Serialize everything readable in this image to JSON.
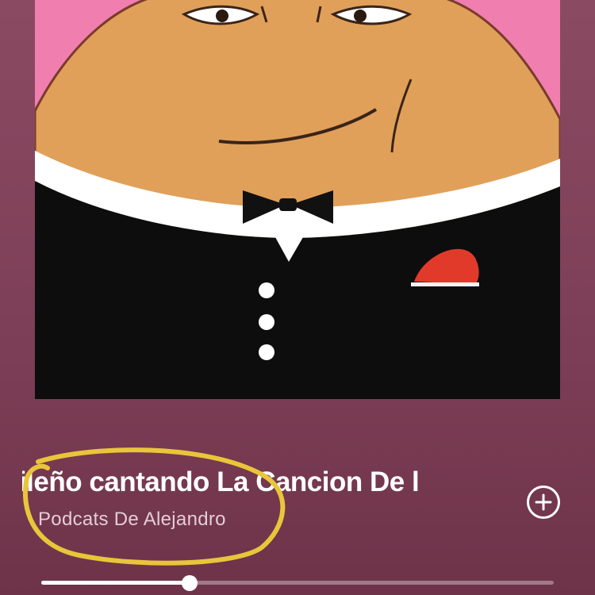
{
  "artwork": {
    "icon": "pou-in-tuxedo-cover-art",
    "background": "#f07fb0"
  },
  "track": {
    "title": "asileño cantando La Cancion De l",
    "subtitle": "Podcats De Alejandro"
  },
  "actions": {
    "add_icon": "plus-circle-icon"
  },
  "playback": {
    "progress": 0.29
  },
  "annotation": {
    "color": "#e8c63a",
    "shape": "hand-drawn-ellipse"
  }
}
